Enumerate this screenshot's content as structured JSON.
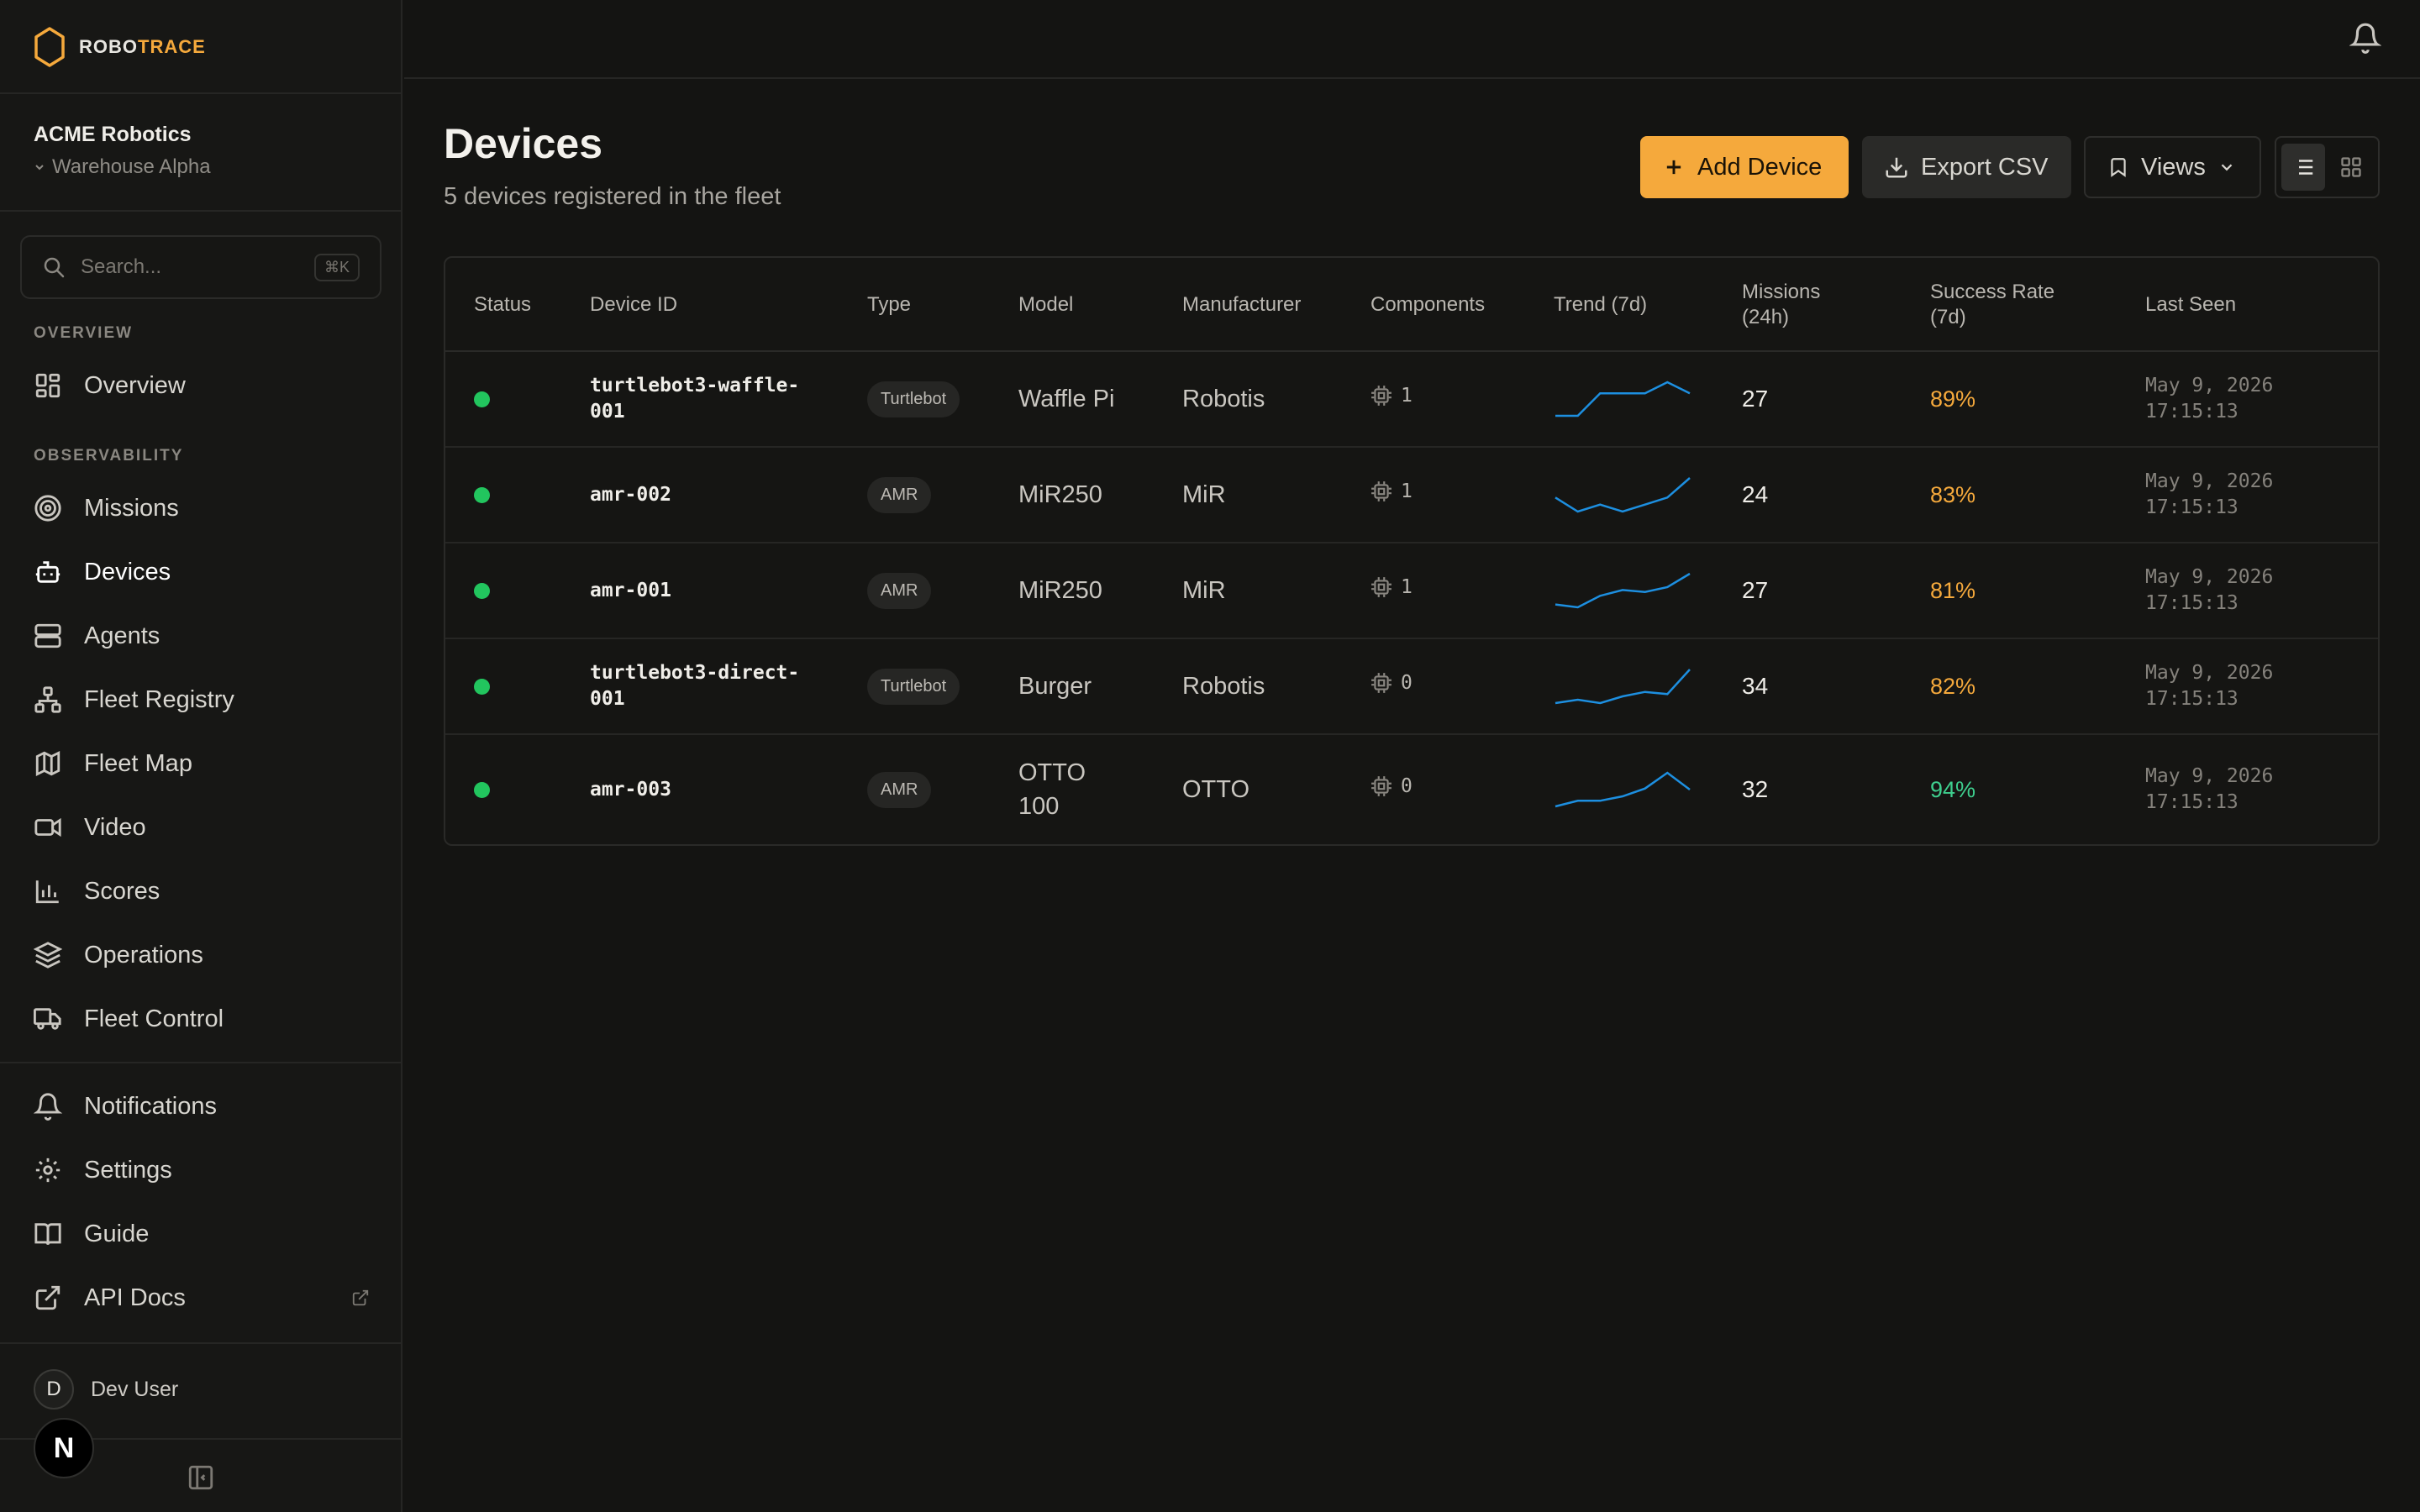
{
  "app": {
    "logo_part1": "ROBO",
    "logo_part2": "TRACE",
    "accent_color": "#f5a93c"
  },
  "org": {
    "name": "ACME Robotics",
    "site": "Warehouse Alpha"
  },
  "search": {
    "placeholder": "Search...",
    "shortcut": "⌘K"
  },
  "sidebar": {
    "section_overview": "OVERVIEW",
    "section_observability": "OBSERVABILITY",
    "items": [
      {
        "label": "Overview",
        "icon": "layout-dashboard-icon"
      },
      {
        "label": "Missions",
        "icon": "target-icon"
      },
      {
        "label": "Devices",
        "icon": "bot-icon",
        "active": true
      },
      {
        "label": "Agents",
        "icon": "server-icon"
      },
      {
        "label": "Fleet Registry",
        "icon": "network-icon"
      },
      {
        "label": "Fleet Map",
        "icon": "map-icon"
      },
      {
        "label": "Video",
        "icon": "video-icon"
      },
      {
        "label": "Scores",
        "icon": "bar-chart-icon"
      },
      {
        "label": "Operations",
        "icon": "layers-icon"
      },
      {
        "label": "Fleet Control",
        "icon": "truck-icon"
      }
    ],
    "footer_items": [
      {
        "label": "Notifications",
        "icon": "bell-icon"
      },
      {
        "label": "Settings",
        "icon": "gear-icon"
      },
      {
        "label": "Guide",
        "icon": "book-icon"
      },
      {
        "label": "API Docs",
        "icon": "external-link-icon"
      }
    ]
  },
  "user": {
    "initial": "D",
    "name": "Dev User",
    "badge": "N"
  },
  "page": {
    "title": "Devices",
    "subtitle": "5 devices registered in the fleet"
  },
  "toolbar": {
    "add_label": "Add Device",
    "export_label": "Export CSV",
    "views_label": "Views"
  },
  "table": {
    "headers": {
      "status": "Status",
      "device_id": "Device ID",
      "type": "Type",
      "model": "Model",
      "manufacturer": "Manufacturer",
      "components": "Components",
      "trend": "Trend (7d)",
      "missions": "Missions\n(24h)",
      "success": "Success Rate\n(7d)",
      "last_seen": "Last Seen"
    },
    "rows": [
      {
        "status": "online",
        "device_id": "turtlebot3-waffle-\n001",
        "type": "Turtlebot",
        "model": "Waffle Pi",
        "manufacturer": "Robotis",
        "components": "1",
        "trend": [
          0,
          0,
          2,
          2,
          2,
          3,
          2
        ],
        "missions": "27",
        "success": "89%",
        "success_color": "#f5a93c",
        "last_seen": "May 9, 2026\n17:15:13"
      },
      {
        "status": "online",
        "device_id": "amr-002",
        "type": "AMR",
        "model": "MiR250",
        "manufacturer": "MiR",
        "components": "1",
        "trend": [
          2,
          1,
          1.5,
          1,
          1.5,
          2,
          3.4
        ],
        "missions": "24",
        "success": "83%",
        "success_color": "#f5a93c",
        "last_seen": "May 9, 2026\n17:15:13"
      },
      {
        "status": "online",
        "device_id": "amr-001",
        "type": "AMR",
        "model": "MiR250",
        "manufacturer": "MiR",
        "components": "1",
        "trend": [
          0.3,
          0,
          1.2,
          1.8,
          1.6,
          2.1,
          3.5
        ],
        "missions": "27",
        "success": "81%",
        "success_color": "#f5a93c",
        "last_seen": "May 9, 2026\n17:15:13"
      },
      {
        "status": "online",
        "device_id": "turtlebot3-direct-\n001",
        "type": "Turtlebot",
        "model": "Burger",
        "manufacturer": "Robotis",
        "components": "0",
        "trend": [
          0,
          0.3,
          0,
          0.6,
          1,
          0.8,
          3
        ],
        "missions": "34",
        "success": "82%",
        "success_color": "#f5a93c",
        "last_seen": "May 9, 2026\n17:15:13"
      },
      {
        "status": "online",
        "device_id": "amr-003",
        "type": "AMR",
        "model": "OTTO\n100",
        "manufacturer": "OTTO",
        "components": "0",
        "trend": [
          0,
          0.5,
          0.5,
          0.9,
          1.6,
          3,
          1.5
        ],
        "missions": "32",
        "success": "94%",
        "success_color": "#3ecf8e",
        "last_seen": "May 9, 2026\n17:15:13"
      }
    ]
  },
  "colors": {
    "status_online": "#22c55e",
    "sparkline": "#1d8fe0"
  }
}
